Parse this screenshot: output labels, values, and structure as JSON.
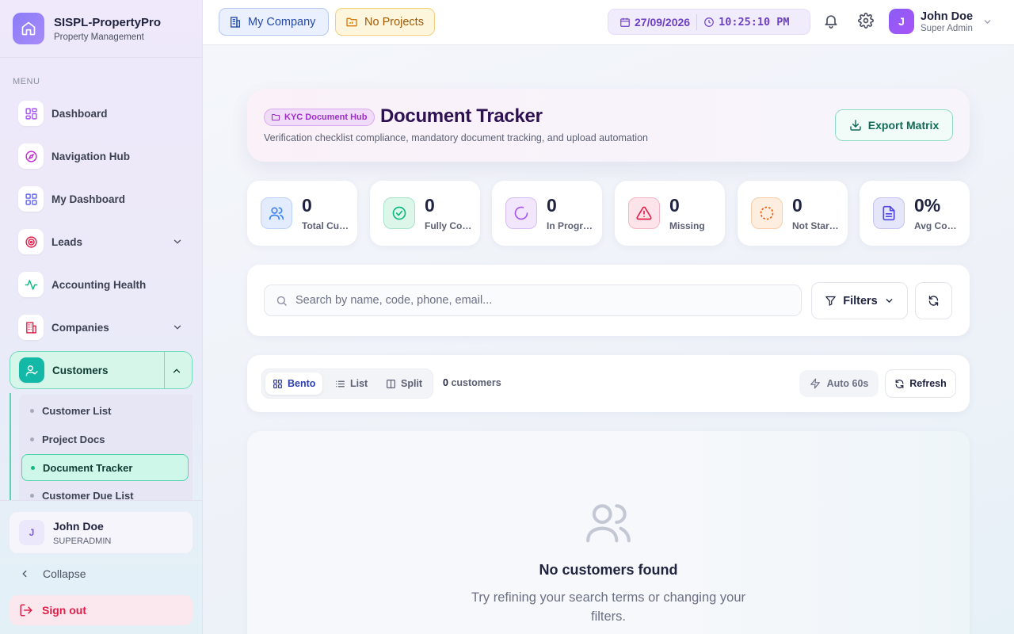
{
  "app": {
    "brand_title": "SISPL-PropertyPro",
    "brand_subtitle": "Property Management",
    "menu_label": "MENU"
  },
  "sidebar": {
    "items": [
      {
        "label": "Dashboard",
        "icon": "grid-icon"
      },
      {
        "label": "Navigation Hub",
        "icon": "compass-icon"
      },
      {
        "label": "My Dashboard",
        "icon": "grid-icon"
      },
      {
        "label": "Leads",
        "icon": "target-icon"
      },
      {
        "label": "Accounting Health",
        "icon": "activity-icon"
      },
      {
        "label": "Companies",
        "icon": "building-icon"
      },
      {
        "label": "Customers",
        "icon": "user-check-icon"
      }
    ],
    "sub_items": [
      {
        "label": "Customer List"
      },
      {
        "label": "Project Docs"
      },
      {
        "label": "Document Tracker"
      },
      {
        "label": "Customer Due List"
      }
    ],
    "user_name": "John Doe",
    "user_role": "SUPERADMIN",
    "user_initial": "J",
    "collapse_label": "Collapse",
    "signout_label": "Sign out"
  },
  "topbar": {
    "company_label": "My Company",
    "projects_label": "No Projects",
    "date": "27/09/2026",
    "time": "10:25:10 PM",
    "user_name": "John Doe",
    "user_role": "Super Admin",
    "user_initial": "J"
  },
  "header": {
    "badge": "KYC Document Hub",
    "title": "Document Tracker",
    "subtitle": "Verification checklist compliance, mandatory document tracking, and upload automation",
    "export_label": "Export Matrix"
  },
  "stats": [
    {
      "value": "0",
      "label": "Total Customers",
      "icon": "users-icon",
      "color": "#3b82f6"
    },
    {
      "value": "0",
      "label": "Fully Compliant",
      "icon": "check-circle-icon",
      "color": "#10b981"
    },
    {
      "value": "0",
      "label": "In Progress",
      "icon": "loader-icon",
      "color": "#a855f7"
    },
    {
      "value": "0",
      "label": "Missing",
      "icon": "alert-triangle-icon",
      "color": "#e11d48"
    },
    {
      "value": "0",
      "label": "Not Started",
      "icon": "dashed-circle-icon",
      "color": "#ea580c"
    },
    {
      "value": "0%",
      "label": "Avg Compliance",
      "icon": "file-text-icon",
      "color": "#4f46e5"
    }
  ],
  "search": {
    "placeholder": "Search by name, code, phone, email...",
    "filters_label": "Filters"
  },
  "view": {
    "modes": [
      {
        "label": "Bento",
        "active": true
      },
      {
        "label": "List",
        "active": false
      },
      {
        "label": "Split",
        "active": false
      }
    ],
    "count_value": "0",
    "count_label": "customers",
    "auto_label": "Auto 60s",
    "refresh_label": "Refresh"
  },
  "empty": {
    "title": "No customers found",
    "subtitle": "Try refining your search terms or changing your filters."
  }
}
